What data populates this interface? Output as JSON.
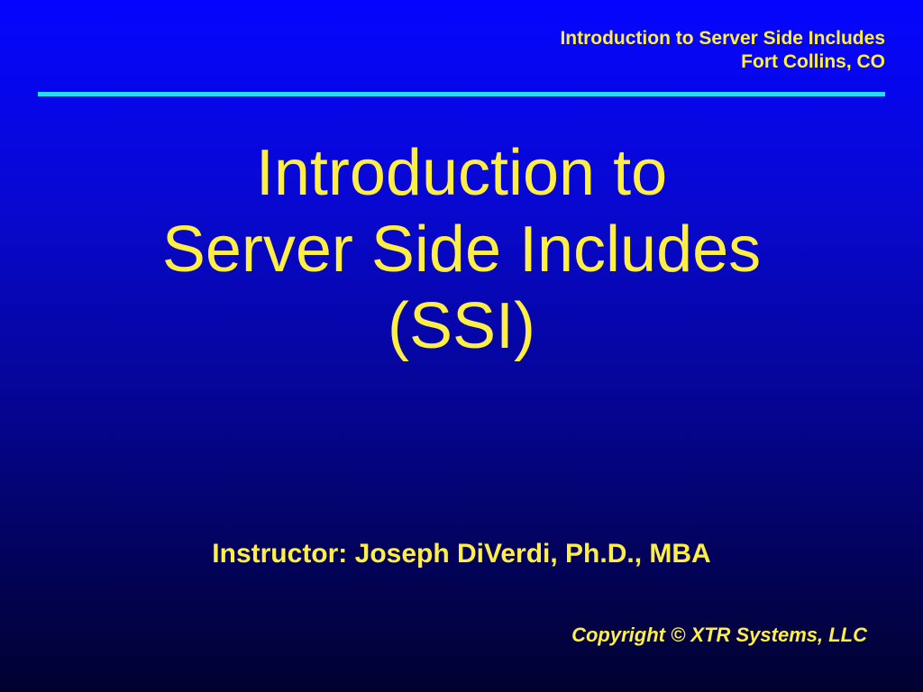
{
  "header": {
    "line1": "Introduction to Server Side Includes",
    "line2": "Fort Collins, CO"
  },
  "title": {
    "line1": "Introduction to",
    "line2": "Server Side Includes",
    "line3": "(SSI)"
  },
  "instructor": "Instructor: Joseph DiVerdi, Ph.D., MBA",
  "copyright": "Copyright © XTR Systems, LLC"
}
